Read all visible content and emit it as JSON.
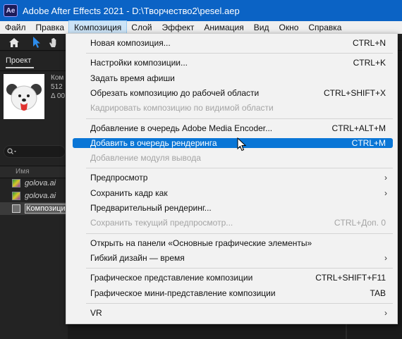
{
  "window": {
    "app_icon_text": "Ae",
    "title": "Adobe After Effects 2021 - D:\\Творчество2\\pesel.aep"
  },
  "menubar": {
    "items": [
      "Файл",
      "Правка",
      "Композиция",
      "Слой",
      "Эффект",
      "Анимация",
      "Вид",
      "Окно",
      "Справка"
    ],
    "active_index": 2
  },
  "project_panel": {
    "tab_label": "Проект",
    "comp_info_lines": [
      "Ком",
      "512",
      "Δ 00"
    ],
    "column_name": "Имя",
    "files": [
      {
        "name": "golova.ai",
        "icon": "illustrator-file-icon"
      },
      {
        "name": "golova.ai",
        "icon": "illustrator-file-icon"
      },
      {
        "name": "Композици",
        "icon": "composition-icon",
        "selected": true
      }
    ]
  },
  "composition_menu": {
    "items": [
      {
        "label": "Новая композиция...",
        "shortcut": "CTRL+N"
      },
      {
        "separator": true
      },
      {
        "label": "Настройки композиции...",
        "shortcut": "CTRL+K"
      },
      {
        "label": "Задать время афиши",
        "shortcut": ""
      },
      {
        "label": "Обрезать композицию до рабочей области",
        "shortcut": "CTRL+SHIFT+X"
      },
      {
        "label": "Кадрировать композицию по видимой области",
        "shortcut": "",
        "disabled": true
      },
      {
        "separator": true
      },
      {
        "label": "Добавление в очередь Adobe Media Encoder...",
        "shortcut": "CTRL+ALT+M"
      },
      {
        "label": "Добавить в очередь рендеринга",
        "shortcut": "CTRL+M",
        "highlighted": true
      },
      {
        "label": "Добавление модуля вывода",
        "shortcut": "",
        "disabled": true
      },
      {
        "separator": true
      },
      {
        "label": "Предпросмотр",
        "shortcut": "",
        "submenu": true
      },
      {
        "label": "Сохранить кадр как",
        "shortcut": "",
        "submenu": true
      },
      {
        "label": "Предварительный рендеринг...",
        "shortcut": ""
      },
      {
        "label": "Сохранить текущий предпросмотр...",
        "shortcut": "CTRL+Доп. 0",
        "disabled": true
      },
      {
        "separator": true
      },
      {
        "label": "Открыть на панели «Основные графические элементы»",
        "shortcut": ""
      },
      {
        "label": "Гибкий дизайн — время",
        "shortcut": "",
        "submenu": true
      },
      {
        "separator": true
      },
      {
        "label": "Графическое представление композиции",
        "shortcut": "CTRL+SHIFT+F11"
      },
      {
        "label": "Графическое мини-представление композиции",
        "shortcut": "TAB"
      },
      {
        "separator": true
      },
      {
        "label": "VR",
        "shortcut": "",
        "submenu": true
      }
    ],
    "submenu_arrow": "›"
  },
  "colors": {
    "titlebar": "#0b63c5",
    "highlight": "#0a76d6",
    "menu_bg": "#f2f2f2",
    "panel_bg": "#232323"
  }
}
